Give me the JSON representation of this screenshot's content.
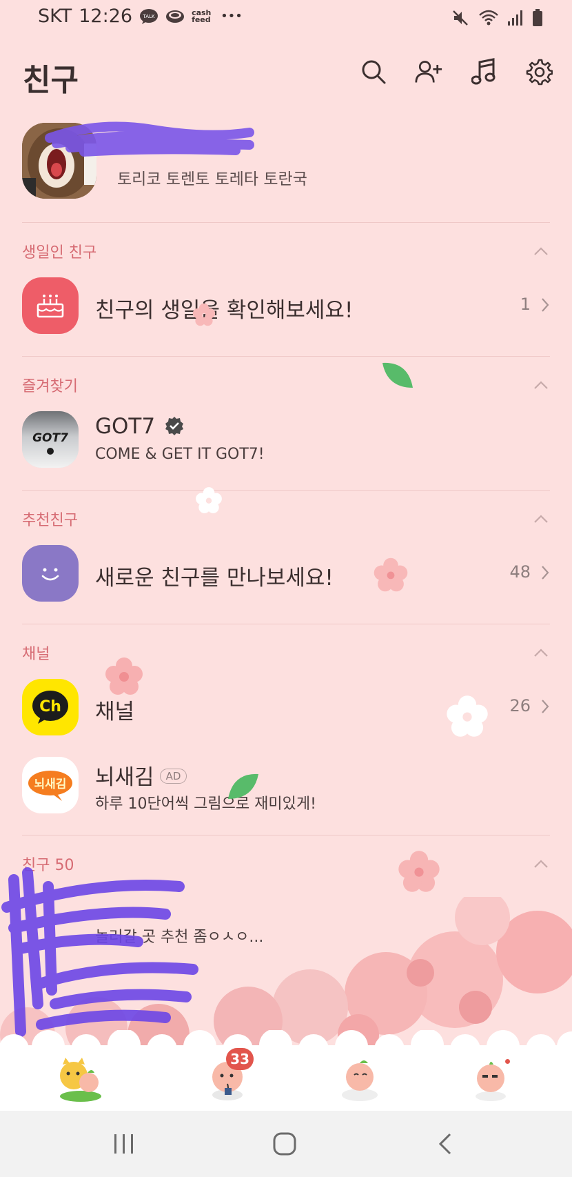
{
  "status_bar": {
    "carrier": "SKT",
    "time": "12:26",
    "notif_talk": "TALK",
    "notif_cash": "cash feed",
    "more": "•••"
  },
  "header": {
    "title": "친구"
  },
  "profile": {
    "status_message": "토리코 토렌토 토레타 토란국"
  },
  "sections": {
    "birthday": {
      "label": "생일인 친구",
      "row_title": "친구의 생일을 확인해보세요!",
      "count": "1"
    },
    "favorites": {
      "label": "즐겨찾기",
      "name": "GOT7",
      "status": "COME & GET IT GOT7!",
      "avatar_text": "GOT7"
    },
    "recommended": {
      "label": "추천친구",
      "row_title": "새로운 친구를 만나보세요!",
      "count": "48"
    },
    "channel": {
      "label": "채널",
      "channel_row_title": "채널",
      "count": "26",
      "channel_icon_text": "Ch",
      "ad_name": "뇌새김",
      "ad_badge": "AD",
      "ad_status": "하루 10단어씩 그림으로 재미있게!",
      "ad_icon_text": "뇌새김"
    },
    "friends": {
      "label": "친구 50",
      "friend1_status": "놀러갈 곳 추천 좀ㅇㅅㅇ..."
    }
  },
  "bottom_tabs": {
    "chats_badge": "33"
  },
  "colors": {
    "background": "#fde0df",
    "section_label": "#d66b73",
    "badge": "#e2554c",
    "channel_yellow": "#ffe600",
    "birthday_red": "#ee5d68",
    "recommend_purple": "#8a78c6"
  }
}
